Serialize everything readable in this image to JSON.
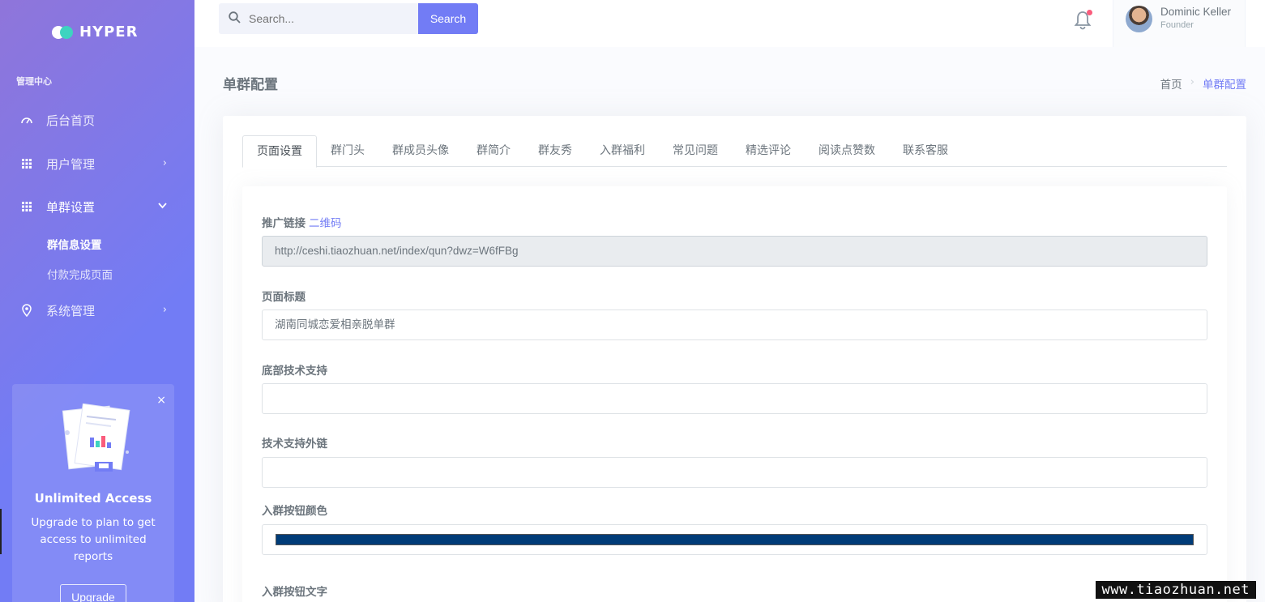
{
  "brand": {
    "name": "HYPER"
  },
  "sidebar": {
    "section_title": "管理中心",
    "items": [
      {
        "label": "后台首页",
        "icon": "dashboard-gauge-icon"
      },
      {
        "label": "用户管理",
        "icon": "grid-icon",
        "chevron": "›"
      },
      {
        "label": "单群设置",
        "icon": "grid-icon",
        "chevron": "⌄",
        "expanded": true
      },
      {
        "label": "系统管理",
        "icon": "map-pin-icon",
        "chevron": "›"
      }
    ],
    "sub_items": [
      {
        "label": "群信息设置",
        "active": true
      },
      {
        "label": "付款完成页面",
        "active": false
      }
    ],
    "promo": {
      "close": "×",
      "title": "Unlimited Access",
      "text": "Upgrade to plan to get access to unlimited reports",
      "button": "Upgrade"
    }
  },
  "topbar": {
    "search_placeholder": "Search...",
    "search_button": "Search",
    "user": {
      "name": "Dominic Keller",
      "role": "Founder"
    }
  },
  "page": {
    "title": "单群配置",
    "breadcrumb": {
      "home": "首页",
      "separator": "›",
      "current": "单群配置"
    }
  },
  "tabs": [
    {
      "label": "页面设置",
      "active": true
    },
    {
      "label": "群门头"
    },
    {
      "label": "群成员头像"
    },
    {
      "label": "群简介"
    },
    {
      "label": "群友秀"
    },
    {
      "label": "入群福利"
    },
    {
      "label": "常见问题"
    },
    {
      "label": "精选评论"
    },
    {
      "label": "阅读点赞数"
    },
    {
      "label": "联系客服"
    }
  ],
  "form": {
    "promo_link": {
      "label": "推广链接",
      "qr_link": "二维码",
      "value": "http://ceshi.tiaozhuan.net/index/qun?dwz=W6fFBg"
    },
    "page_title": {
      "label": "页面标题",
      "value": "湖南同城恋爱相亲脱单群"
    },
    "footer_support": {
      "label": "底部技术支持",
      "value": ""
    },
    "support_link": {
      "label": "技术支持外链",
      "value": ""
    },
    "button_color": {
      "label": "入群按钮颜色",
      "value": "#003c78"
    },
    "button_text": {
      "label": "入群按钮文字"
    }
  },
  "watermark": "www.tiaozhuan.net",
  "colors": {
    "primary": "#727cf5",
    "sidebar_start": "#8f75da",
    "accent_teal": "#3ed3c0",
    "badge": "#fa5c7c"
  }
}
